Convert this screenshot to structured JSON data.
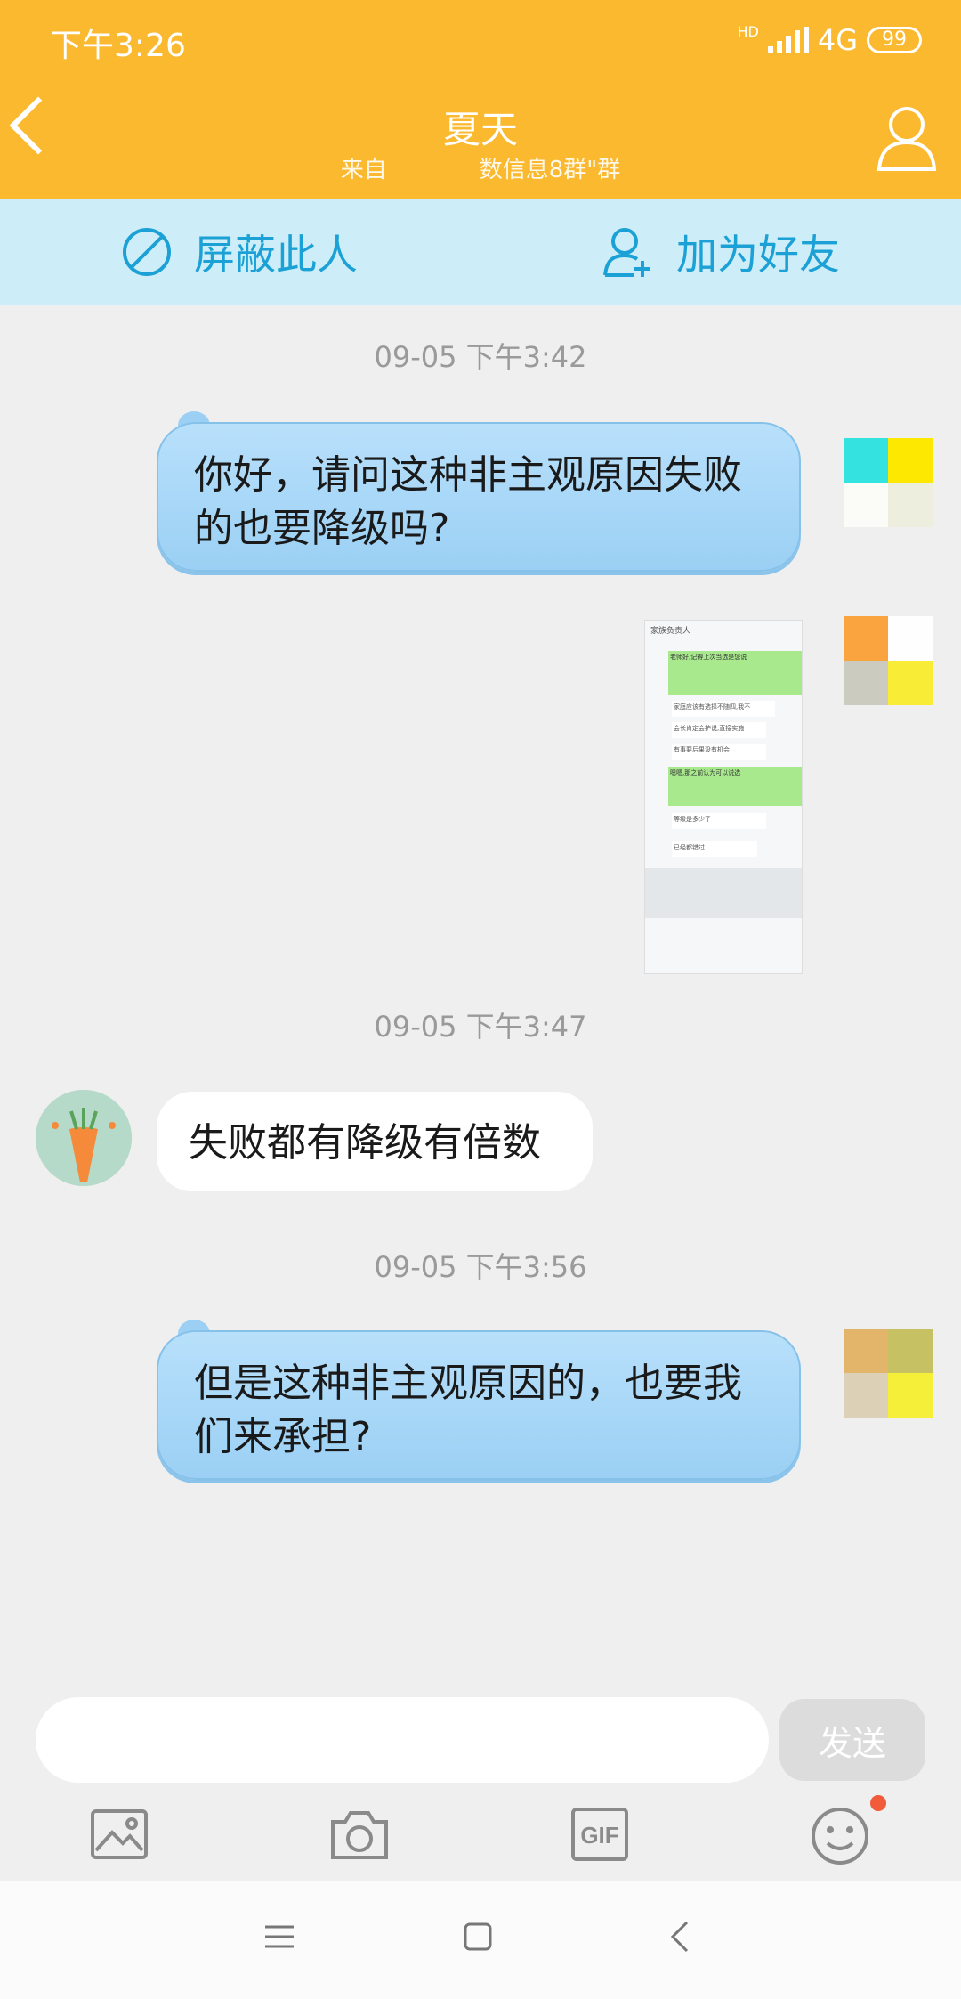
{
  "status_bar": {
    "time": "下午3:26",
    "network": "4G",
    "hd": "HD",
    "battery": "99"
  },
  "header": {
    "title": "夏天",
    "subtitle": "来自　　　　数信息8群\"群"
  },
  "actions": {
    "block_label": "屏蔽此人",
    "add_friend_label": "加为好友"
  },
  "messages": [
    {
      "timestamp": "09-05 下午3:42"
    },
    {
      "side": "right",
      "text": "你好，请问这种非主观原因失败的也要降级吗?"
    },
    {
      "side": "right",
      "type": "image"
    },
    {
      "timestamp": "09-05 下午3:47"
    },
    {
      "side": "left",
      "text": "失败都有降级有倍数"
    },
    {
      "timestamp": "09-05 下午3:56"
    },
    {
      "side": "right",
      "text": "但是这种非主观原因的，也要我们来承担?"
    }
  ],
  "screenshot_lines": [
    "家族负责人",
    "老师好,记得上次当选是您说",
    "失方失误后赔,现在没定不知道",
    "家庭应该有选择不随四,我不",
    "都是有些就说的",
    "会长肯定会护说,直接实施",
    "有事要后果没有机会",
    "嗯嗯,那之前认为可以说选",
    "别说说说吧当有理由",
    "等级是多少了",
    "已经都错过"
  ],
  "input": {
    "placeholder": "",
    "value": ""
  },
  "send_label": "发送",
  "toolbar": {
    "icons": [
      "image-icon",
      "camera-icon",
      "gif-icon",
      "emoji-icon"
    ],
    "gif_text": "GIF"
  },
  "colors": {
    "header": "#fbb930",
    "action_text": "#1ba1d5",
    "bubble_right": "#9bd0f4",
    "badge": "#f15a3a"
  }
}
